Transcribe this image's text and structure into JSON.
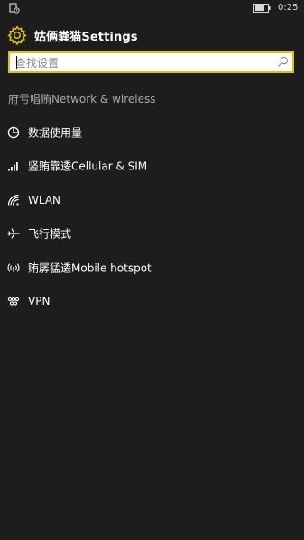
{
  "status_bar": {
    "time": "0:25",
    "left_icon": "data-saver-icon",
    "battery_icon": "battery-icon"
  },
  "header": {
    "title": "姑俩粪猫Settings",
    "icon": "gear-icon"
  },
  "search": {
    "placeholder": "查找设置",
    "value": "",
    "icon": "search-icon"
  },
  "section": {
    "title": "府亏唱贿Network & wireless"
  },
  "menu": {
    "items": [
      {
        "label": "数据使用量",
        "icon": "pie-chart-icon"
      },
      {
        "label": "竖贿靠逶Cellular & SIM",
        "icon": "signal-bars-icon"
      },
      {
        "label": "WLAN",
        "icon": "wifi-icon"
      },
      {
        "label": "飞行模式",
        "icon": "airplane-icon"
      },
      {
        "label": "贿孱猛逶Mobile hotspot",
        "icon": "hotspot-icon"
      },
      {
        "label": "VPN",
        "icon": "vpn-icon"
      }
    ]
  },
  "colors": {
    "background": "#1d1d1d",
    "accent": "#e4c200",
    "text": "#ffffff",
    "section_text": "#a8a8a8"
  }
}
